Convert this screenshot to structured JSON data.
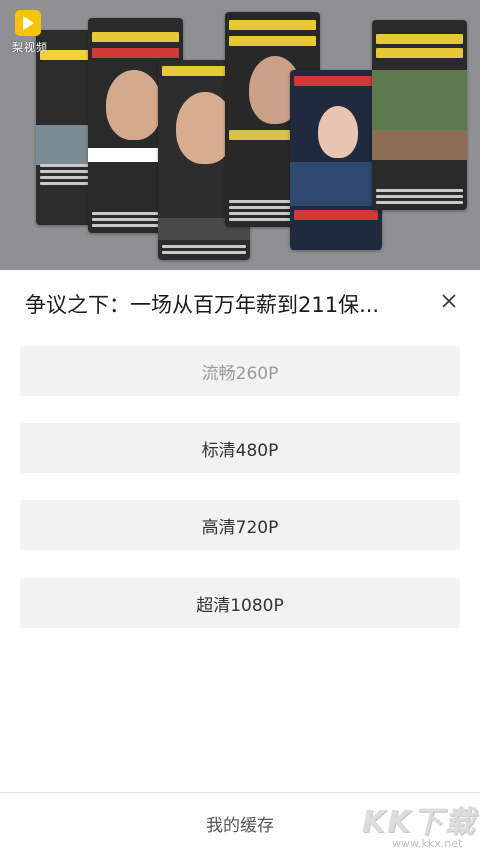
{
  "player": {
    "logo_text": "梨视频"
  },
  "sheet": {
    "title": "争议之下：一场从百万年薪到211保...",
    "close_icon": "close-icon",
    "quality_options": [
      {
        "label": "流畅260P",
        "state": "current"
      },
      {
        "label": "标清480P",
        "state": "available"
      },
      {
        "label": "高清720P",
        "state": "available"
      },
      {
        "label": "超清1080P",
        "state": "available"
      }
    ],
    "my_cache_label": "我的缓存"
  },
  "watermark": {
    "main": "KK下载",
    "sub": "www.kkx.net"
  },
  "colors": {
    "logo_yellow": "#f6c400",
    "button_bg": "#f2f2f2",
    "current_option_text": "#9b9b9b"
  }
}
